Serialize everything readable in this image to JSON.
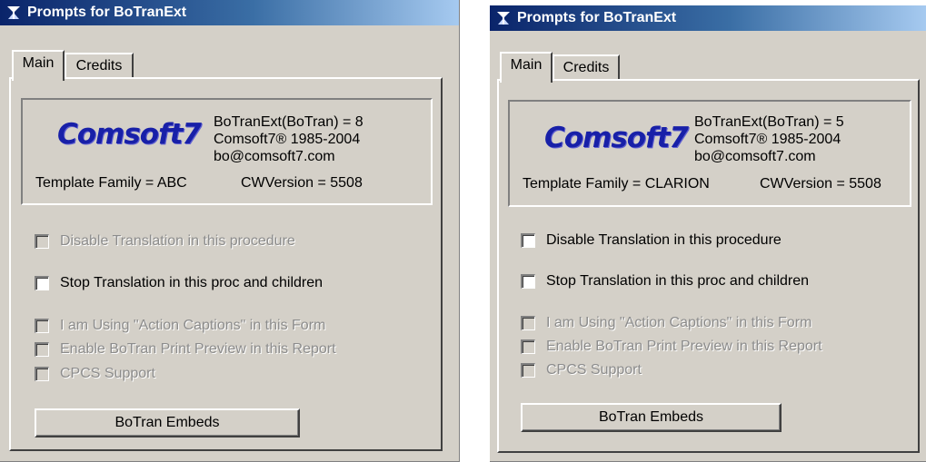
{
  "colors": {
    "window_bg": "#d4d0c8",
    "title_start": "#0a246a",
    "title_end": "#a6caf0",
    "logo": "#1820a8",
    "disabled_text": "#8c8c8c"
  },
  "windows": [
    {
      "title": "Prompts for BoTranExt",
      "tabs": [
        "Main",
        "Credits"
      ],
      "logo": "Comsoft7",
      "info": {
        "line1": "BoTranExt(BoTran) = 8",
        "line2": "Comsoft7® 1985-2004",
        "line3": "bo@comsoft7.com"
      },
      "template_family": "Template Family = ABC",
      "cw_version": "CWVersion = 5508",
      "checkboxes": [
        {
          "label": "Disable Translation in this procedure",
          "disabled": true,
          "checked": false
        },
        {
          "label": "Stop Translation in this proc and children",
          "disabled": false,
          "checked": false
        },
        {
          "label": "I am Using \"Action Captions\" in this Form",
          "disabled": true,
          "checked": false
        },
        {
          "label": "Enable BoTran Print Preview in this Report",
          "disabled": true,
          "checked": false
        },
        {
          "label": "CPCS Support",
          "disabled": true,
          "checked": false
        }
      ],
      "button": "BoTran Embeds"
    },
    {
      "title": "Prompts for BoTranExt",
      "tabs": [
        "Main",
        "Credits"
      ],
      "logo": "Comsoft7",
      "info": {
        "line1": "BoTranExt(BoTran) = 5",
        "line2": "Comsoft7® 1985-2004",
        "line3": "bo@comsoft7.com"
      },
      "template_family": "Template Family = CLARION",
      "cw_version": "CWVersion = 5508",
      "checkboxes": [
        {
          "label": "Disable Translation in this procedure",
          "disabled": false,
          "checked": false
        },
        {
          "label": "Stop Translation in this proc and children",
          "disabled": false,
          "checked": false
        },
        {
          "label": "I am Using \"Action Captions\" in this Form",
          "disabled": true,
          "checked": false
        },
        {
          "label": "Enable BoTran Print Preview in this Report",
          "disabled": true,
          "checked": false
        },
        {
          "label": "CPCS Support",
          "disabled": true,
          "checked": false
        }
      ],
      "button": "BoTran Embeds"
    }
  ]
}
